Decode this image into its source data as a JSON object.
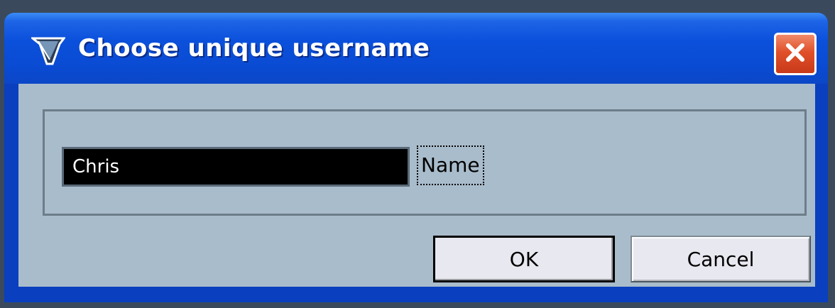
{
  "window": {
    "title": "Choose unique username",
    "app_icon": "app-logo-icon",
    "close_icon": "close-icon"
  },
  "form": {
    "name_value": "Chris",
    "name_label": "Name"
  },
  "buttons": {
    "ok_label": "OK",
    "cancel_label": "Cancel"
  },
  "colors": {
    "titlebar": "#0b50db",
    "client_bg": "#a9bccb",
    "input_bg": "#000000",
    "input_text": "#ffffff",
    "close_button": "#e0502a"
  }
}
